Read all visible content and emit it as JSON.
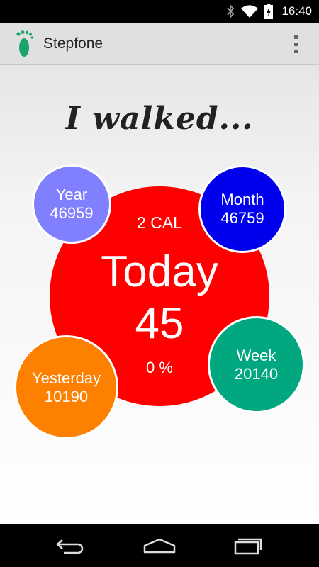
{
  "status_bar": {
    "time": "16:40",
    "icons": [
      "bluetooth-icon",
      "wifi-icon",
      "battery-charging-icon"
    ]
  },
  "app_bar": {
    "title": "Stepfone",
    "icon": "footprint-icon",
    "menu_icon": "overflow-menu-icon"
  },
  "headline": "I walked...",
  "today": {
    "calories": "2 CAL",
    "label": "Today",
    "steps": "45",
    "percent": "0 %",
    "color": "#fe0000"
  },
  "year": {
    "label": "Year",
    "value": "46959",
    "color": "#8080fe"
  },
  "month": {
    "label": "Month",
    "value": "46759",
    "color": "#0000ec"
  },
  "yesterday": {
    "label": "Yesterday",
    "value": "10190",
    "color": "#fe8000"
  },
  "week": {
    "label": "Week",
    "value": "20140",
    "color": "#00a77f"
  },
  "nav_bar": {
    "buttons": [
      "back-icon",
      "home-icon",
      "recents-icon"
    ]
  }
}
